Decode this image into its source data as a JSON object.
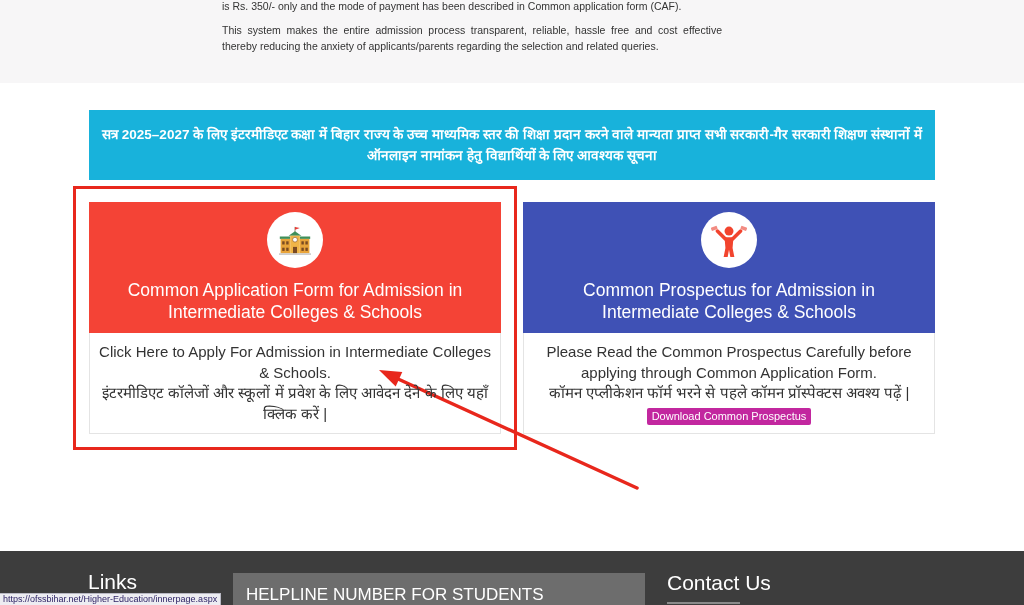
{
  "intro": {
    "paragraphs": [
      "is Rs. 350/- only and the mode of payment has been described in Common application form (CAF).",
      "This system makes the entire admission process transparent, reliable, hassle free and cost effective thereby reducing the anxiety of applicants/parents regarding the selection and related queries."
    ]
  },
  "notice_banner": {
    "text": "सत्र 2025–2027 के लिए इंटरमीडिएट कक्षा में बिहार राज्य के उच्च माध्यमिक स्तर की शिक्षा प्रदान करने वाले मान्यता प्राप्त सभी सरकारी-गैर सरकारी शिक्षण संस्थानों में ऑनलाइन नामांकन हेतु विद्यार्थियों के लिए आवश्यक सूचना"
  },
  "cards": [
    {
      "kind": "apply",
      "color": "#f44336",
      "highlighted": true,
      "title": "Common Application Form for Admission in Intermediate Colleges & Schools",
      "body": [
        "Click Here to Apply For Admission in Intermediate Colleges & Schools.",
        "इंटरमीडिएट कॉलेजों और स्कूलों में प्रवेश के लिए आवेदन देने के लिए यहाँ क्लिक करें |"
      ]
    },
    {
      "kind": "prospectus",
      "color": "#3f51b5",
      "highlighted": false,
      "title": "Common Prospectus for Admission in Intermediate Colleges & Schools",
      "body": [
        "Please Read the Common Prospectus Carefully before applying through Common Application Form.",
        "कॉमन एप्लीकेशन फॉर्म भरने से पहले कॉमन प्रॉस्पेक्टस अवश्य पढ़ें |"
      ],
      "button": "Download Common Prospectus"
    }
  ],
  "footer": {
    "links_heading": "Links",
    "helpline_heading": "HELPLINE NUMBER FOR STUDENTS",
    "contact_heading": "Contact Us"
  },
  "status_url": "https://ofssbihar.net/Higher-Education/innerpage.aspx"
}
